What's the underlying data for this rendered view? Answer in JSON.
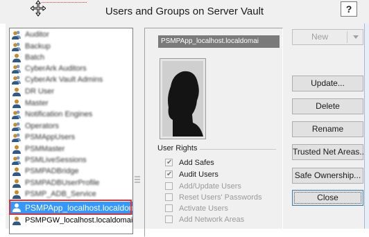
{
  "window": {
    "title": "Users and Groups on Server Vault",
    "help_label": "?"
  },
  "user_list": {
    "items": [
      {
        "label": "Auditor",
        "icon": "group-icon",
        "blurred": true,
        "selected": false
      },
      {
        "label": "Backup",
        "icon": "group-icon",
        "blurred": true,
        "selected": false
      },
      {
        "label": "Batch",
        "icon": "user-icon",
        "blurred": true,
        "selected": false
      },
      {
        "label": "CyberArk Auditors",
        "icon": "group-icon",
        "blurred": true,
        "selected": false
      },
      {
        "label": "CyberArk Vault Admins",
        "icon": "group-icon",
        "blurred": true,
        "selected": false
      },
      {
        "label": "DR User",
        "icon": "user-icon",
        "blurred": true,
        "selected": false
      },
      {
        "label": "Master",
        "icon": "user-icon",
        "blurred": true,
        "selected": false
      },
      {
        "label": "Notification Engines",
        "icon": "group-icon",
        "blurred": true,
        "selected": false
      },
      {
        "label": "Operators",
        "icon": "group-icon",
        "blurred": true,
        "selected": false
      },
      {
        "label": "PSMAppUsers",
        "icon": "group-icon",
        "blurred": true,
        "selected": false
      },
      {
        "label": "PSMMaster",
        "icon": "user-icon",
        "blurred": true,
        "selected": false
      },
      {
        "label": "PSMLiveSessions",
        "icon": "group-icon",
        "blurred": true,
        "selected": false
      },
      {
        "label": "PSMPADBridge",
        "icon": "user-icon",
        "blurred": true,
        "selected": false
      },
      {
        "label": "PSMPADBUserProfile",
        "icon": "user-icon",
        "blurred": true,
        "selected": false
      },
      {
        "label": "PSMP_ADB_Service",
        "icon": "user-icon",
        "blurred": true,
        "selected": false
      },
      {
        "label": "PSMPApp_localhost.localdomai",
        "icon": "user-icon",
        "blurred": false,
        "selected": true
      },
      {
        "label": "PSMPGW_localhost.localdomain",
        "icon": "user-icon",
        "blurred": false,
        "selected": false
      }
    ]
  },
  "details": {
    "name": "PSMPApp_localhost.localdomai",
    "photo_icon": "user-photo",
    "rights_title": "User Rights",
    "rights": [
      {
        "label": "Add Safes",
        "checked": true,
        "enabled": true
      },
      {
        "label": "Audit Users",
        "checked": true,
        "enabled": true
      },
      {
        "label": "Add/Update Users",
        "checked": false,
        "enabled": false
      },
      {
        "label": "Reset Users' Passwords",
        "checked": false,
        "enabled": false
      },
      {
        "label": "Activate Users",
        "checked": false,
        "enabled": false
      },
      {
        "label": "Add Network Areas",
        "checked": false,
        "enabled": false
      }
    ]
  },
  "buttons": {
    "new": "New",
    "update": "Update...",
    "delete": "Delete",
    "rename": "Rename",
    "trusted": "Trusted Net Areas...",
    "safe_ownership": "Safe Ownership...",
    "close": "Close"
  },
  "colors": {
    "selection": "#3399ff",
    "highlight_outline": "#e03030",
    "name_field_bg": "#7a7a7a"
  }
}
